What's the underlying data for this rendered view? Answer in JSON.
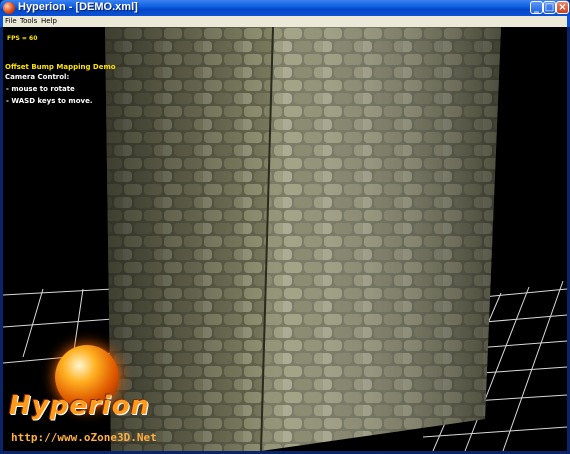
{
  "window": {
    "title": "Hyperion - [DEMO.xml]",
    "controls": {
      "minimize": "_",
      "maximize": "□",
      "close": "×"
    }
  },
  "menu": {
    "items": [
      "File",
      "Tools",
      "Help"
    ]
  },
  "hud": {
    "fps": "FPS = 60",
    "demo_title": "Offset Bump Mapping Demo",
    "camera_heading": "Camera Control:",
    "line1": "- mouse to rotate",
    "line2": "- WASD keys to move."
  },
  "logo": {
    "name": "Hyperion",
    "url": "http://www.oZone3D.Net"
  },
  "colors": {
    "hud_yellow": "#ffe400",
    "title_blue": "#0b5ce0",
    "stone": "#8a8a6a",
    "grid": "#ffffff"
  }
}
